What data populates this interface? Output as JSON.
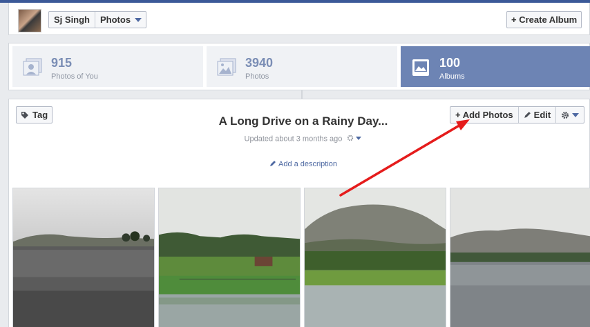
{
  "header": {
    "user_name": "Sj Singh",
    "section": "Photos",
    "create_album_label": "+ Create Album"
  },
  "stats": [
    {
      "count": "915",
      "label": "Photos of You",
      "icon": "photos-of-you-icon"
    },
    {
      "count": "3940",
      "label": "Photos",
      "icon": "photos-icon"
    },
    {
      "count": "100",
      "label": "Albums",
      "icon": "albums-icon"
    }
  ],
  "album": {
    "tag_label": "Tag",
    "title": "A Long Drive on a Rainy Day...",
    "updated": "Updated about 3 months ago",
    "add_description": "Add a description",
    "add_photos_label": "+ Add Photos",
    "edit_label": "Edit"
  },
  "colors": {
    "brand": "#3b5998",
    "active_tab": "#6d84b4",
    "annotation_arrow": "#e51c1c"
  }
}
